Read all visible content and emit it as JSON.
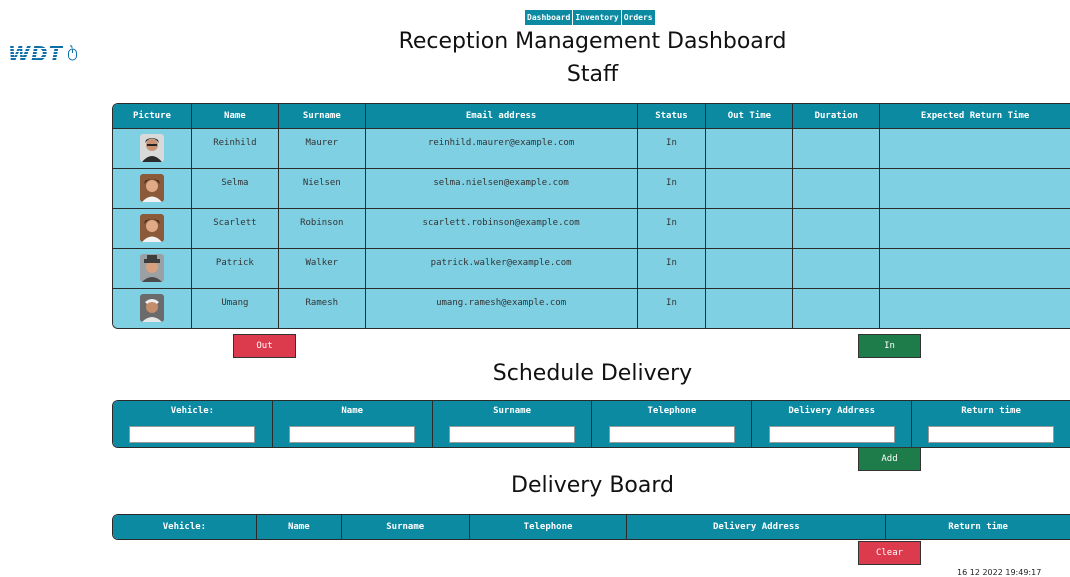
{
  "logo": {
    "text": "WDT"
  },
  "nav": {
    "items": [
      "Dashboard",
      "Inventory",
      "Orders"
    ]
  },
  "page_title": "Reception Management Dashboard",
  "staff": {
    "heading": "Staff",
    "columns": [
      "Picture",
      "Name",
      "Surname",
      "Email address",
      "Status",
      "Out Time",
      "Duration",
      "Expected Return Time"
    ],
    "rows": [
      {
        "name": "Reinhild",
        "surname": "Maurer",
        "email": "reinhild.maurer@example.com",
        "status": "In",
        "out_time": "",
        "duration": "",
        "expected_return": ""
      },
      {
        "name": "Selma",
        "surname": "Nielsen",
        "email": "selma.nielsen@example.com",
        "status": "In",
        "out_time": "",
        "duration": "",
        "expected_return": ""
      },
      {
        "name": "Scarlett",
        "surname": "Robinson",
        "email": "scarlett.robinson@example.com",
        "status": "In",
        "out_time": "",
        "duration": "",
        "expected_return": ""
      },
      {
        "name": "Patrick",
        "surname": "Walker",
        "email": "patrick.walker@example.com",
        "status": "In",
        "out_time": "",
        "duration": "",
        "expected_return": ""
      },
      {
        "name": "Umang",
        "surname": "Ramesh",
        "email": "umang.ramesh@example.com",
        "status": "In",
        "out_time": "",
        "duration": "",
        "expected_return": ""
      }
    ],
    "out_button": "Out",
    "in_button": "In"
  },
  "schedule": {
    "heading": "Schedule Delivery",
    "columns": [
      "Vehicle:",
      "Name",
      "Surname",
      "Telephone",
      "Delivery Address",
      "Return time"
    ],
    "inputs": [
      "",
      "",
      "",
      "",
      "",
      ""
    ],
    "add_button": "Add"
  },
  "board": {
    "heading": "Delivery Board",
    "columns": [
      "Vehicle:",
      "Name",
      "Surname",
      "Telephone",
      "Delivery Address",
      "Return time"
    ],
    "clear_button": "Clear"
  },
  "timestamp": "16 12 2022 19:49:17",
  "colors": {
    "header_bg": "#0b8aa2",
    "row_bg": "#7fd0e3",
    "red_button": "#dc3b4e",
    "green_button": "#1e7c4a",
    "logo": "#0e6fa8"
  }
}
